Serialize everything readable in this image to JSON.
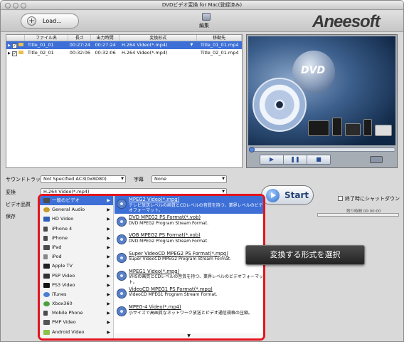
{
  "window": {
    "title": "DVDビデオ変換 for Mac(登録済み)"
  },
  "toolbar": {
    "load_label": "Load...",
    "edit_label": "編集",
    "logo_text": "Aneesoft"
  },
  "file_list": {
    "columns": [
      "ファイル名",
      "長さ",
      "出力時間",
      "変換形式",
      "移動先"
    ],
    "rows": [
      {
        "name": "Title_01_01",
        "length": "00:27:24",
        "output_time": "00:27:24",
        "format": "H.264 Video(*.mp4)",
        "dest": "Title_01_01.mp4",
        "selected": true
      },
      {
        "name": "Title_02_01",
        "length": "00:32:06",
        "output_time": "00:32:06",
        "format": "H.264 Video(*.mp4)",
        "dest": "Title_02_01.mp4",
        "selected": false
      }
    ]
  },
  "preview": {
    "dvd_text": "DVD",
    "controls": [
      "▶",
      "❚❚",
      "■"
    ]
  },
  "settings": {
    "subtitle_track_label": "サウンドトラック",
    "subtitle_track_value": "Not Specified AC3(0x8D80)",
    "caption_label": "字幕",
    "caption_value": "None",
    "convert_label": "変換",
    "convert_value": "H.264 Video(*.mp4)",
    "quality_label": "ビデオ品質",
    "save_label": "保存"
  },
  "start_label": "Start",
  "shutdown_label": "終了時にシャットダウン",
  "remaining_label": "残り時間 00:00:00",
  "menu": {
    "categories": [
      {
        "label": "一般のビデオ",
        "selected": true
      },
      {
        "label": "General Audio"
      },
      {
        "label": "HD Video"
      },
      {
        "label": "iPhone 4"
      },
      {
        "label": "iPhone"
      },
      {
        "label": "iPad"
      },
      {
        "label": "iPod"
      },
      {
        "label": "Apple TV"
      },
      {
        "label": "PSP Video"
      },
      {
        "label": "PS3 Video"
      },
      {
        "label": "iTunes"
      },
      {
        "label": "Xbox360"
      },
      {
        "label": "Mobile Phone"
      },
      {
        "label": "PMP Video"
      },
      {
        "label": "Android Video"
      }
    ],
    "formats": [
      {
        "title": "MPEG2 Video(*.mpg)",
        "desc": "テレビ放送レベルの画質とCDレベルの音質を持つ、業界レベルのビデオフォーマット。",
        "selected": true
      },
      {
        "title": "DVD MPEG2 PS Format(*.vob)",
        "desc": "DVD MPEG2 Program Stream Format."
      },
      {
        "title": "VOB MPEG2 PS Format(*.vob)",
        "desc": "DVD MPEG2 Program Stream Format."
      },
      {
        "title": "Super VideoCD MPEG2 PS Format(*.mpg)",
        "desc": "Super VideoCD MPEG2 Program Stream Format."
      },
      {
        "title": "MPEG1 Video(*.mpg)",
        "desc": "VHSの画質とCDレベルの音質を持つ、業界レベルのビデオフォーマット。"
      },
      {
        "title": "VideoCD MPEG1 PS Format(*.mpg)",
        "desc": "VideoCD MPEG1 Program Stream Format."
      },
      {
        "title": "MPEG-4 Video(*.mp4)",
        "desc": "小サイズで高画質なネットワーク放送とビデオ通信規格の圧縮。"
      }
    ],
    "scroll_indicator": "▼"
  },
  "callout_text": "変換する形式を選択"
}
